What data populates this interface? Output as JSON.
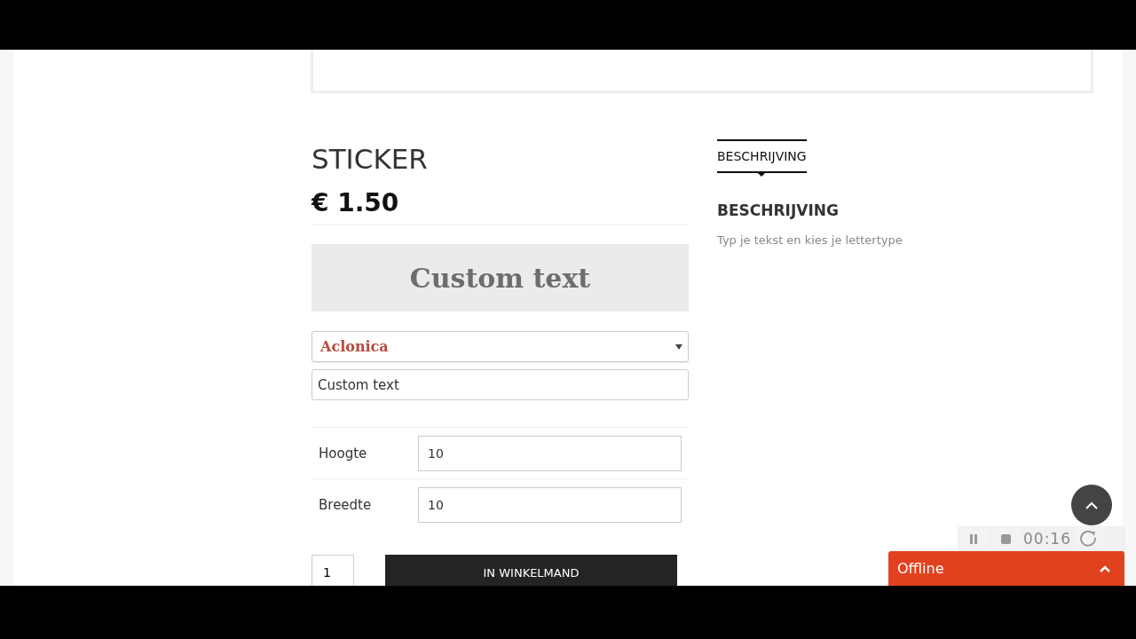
{
  "product": {
    "title": "STICKER",
    "price": "€ 1.50",
    "preview_text": "Custom text",
    "font_select": {
      "value": "Aclonica"
    },
    "text_field": {
      "value": "Custom text"
    },
    "options": [
      {
        "label": "Hoogte",
        "value": "10"
      },
      {
        "label": "Breedte",
        "value": "10"
      }
    ],
    "quantity": "1",
    "add_to_cart": "IN WINKELMAND"
  },
  "tabs": [
    {
      "label": "BESCHRIJVING",
      "selected": true
    }
  ],
  "description": {
    "heading": "BESCHRIJVING",
    "text": "Typ je tekst en kies je lettertype"
  },
  "recorder": {
    "time": "00:16"
  },
  "chat": {
    "label": "Offline"
  }
}
